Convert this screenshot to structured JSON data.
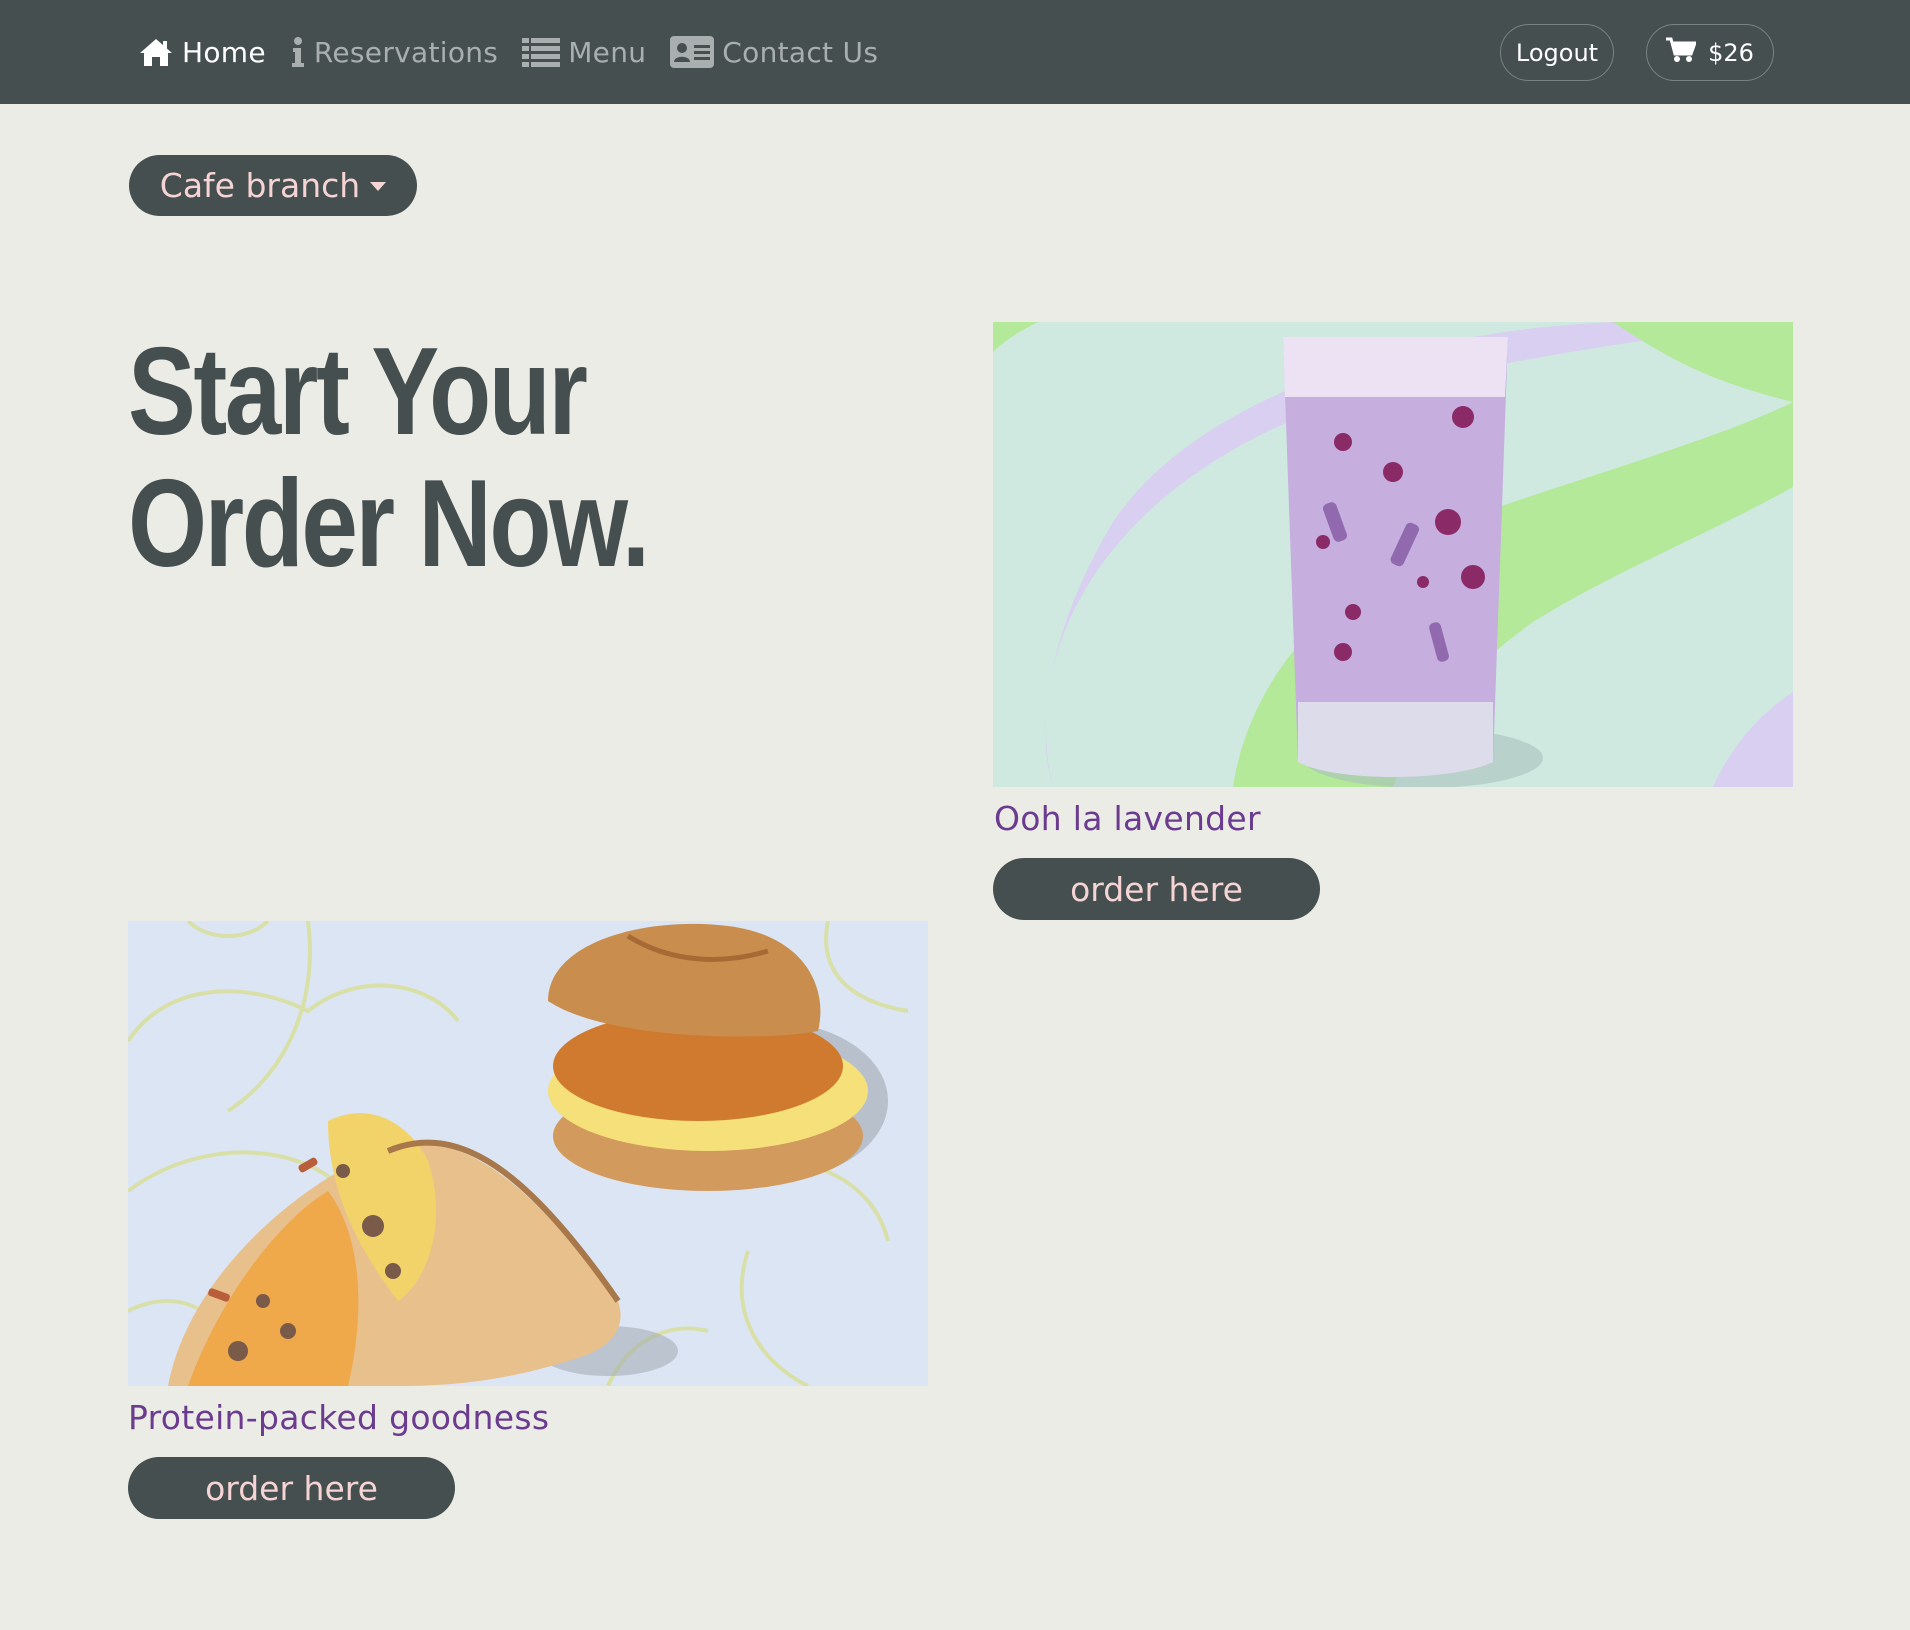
{
  "nav": {
    "links": [
      {
        "label": "Home",
        "icon": "home-icon",
        "active": true
      },
      {
        "label": "Reservations",
        "icon": "info-icon",
        "active": false
      },
      {
        "label": "Menu",
        "icon": "list-icon",
        "active": false
      },
      {
        "label": "Contact Us",
        "icon": "contact-card-icon",
        "active": false
      }
    ],
    "logout_label": "Logout",
    "cart_total": "$26"
  },
  "branch_selector": {
    "label": "Cafe branch"
  },
  "hero": {
    "title": "Start Your Order Now."
  },
  "cards": [
    {
      "title": "Ooh la lavender",
      "button_label": "order here",
      "image": "lavender-drink"
    },
    {
      "title": "Protein-packed goodness",
      "button_label": "order here",
      "image": "breakfast-sandwich-and-wrap"
    }
  ],
  "colors": {
    "navbar": "#454f4f",
    "background": "#ecece7",
    "accent_text": "#6a3b8e",
    "button_text": "#f6d4d4"
  }
}
